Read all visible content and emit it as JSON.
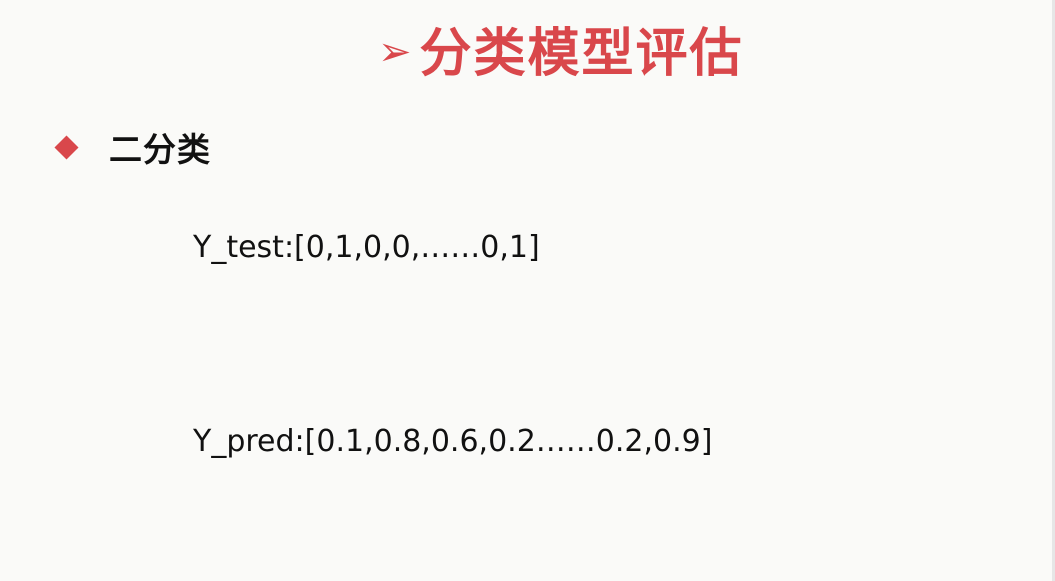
{
  "slide": {
    "title": "分类模型评估",
    "title_icon": "arrow-bullet-icon",
    "subtitle": "二分类",
    "bullet_icon": "red-diamond-icon",
    "y_test": "Y_test:[0,1,0,0,……0,1]",
    "y_pred": "Y_pred:[0.1,0.8,0.6,0.2……0.2,0.9]",
    "accent_color": "#d9474b",
    "text_color": "#111111"
  }
}
